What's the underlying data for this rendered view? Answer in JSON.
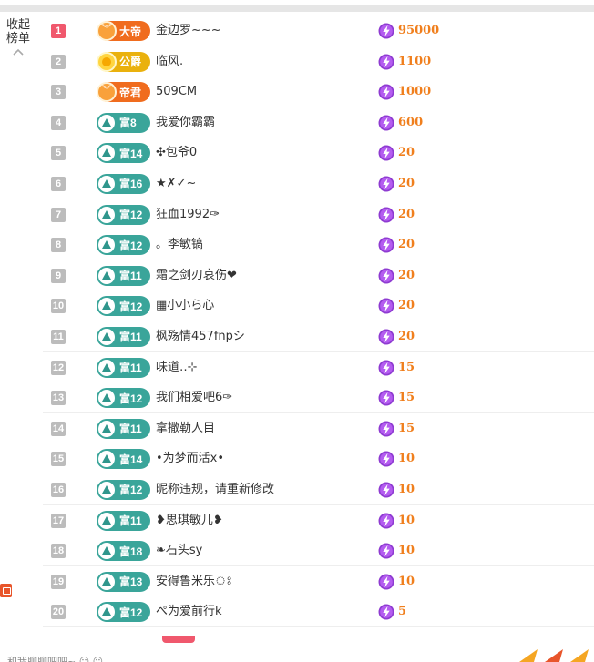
{
  "sidebar": {
    "collapse_label": "收起榜单"
  },
  "colors": {
    "fu_badge": "#3aa59a",
    "noble_orange": "#f06c1e",
    "noble_gold": "#eab10d",
    "amount": "#f07f1d",
    "rank_top": "#f0586d",
    "rank_default": "#bcbcbc",
    "bolt": "#8e3bd1"
  },
  "icons": {
    "collapse": "chevron-up-icon",
    "bolt": "lightning-bolt-icon",
    "fu_gem": "wealth-level-icon",
    "noble_gem": "noble-rank-icon"
  },
  "leaderboard": [
    {
      "rank": "1",
      "badge_type": "orange",
      "badge_label": "大帝",
      "name": "金边罗~~~",
      "amount": "95000"
    },
    {
      "rank": "2",
      "badge_type": "gold",
      "badge_label": "公爵",
      "name": "临风.",
      "amount": "1100"
    },
    {
      "rank": "3",
      "badge_type": "orange",
      "badge_label": "帝君",
      "name": "509CM",
      "amount": "1000"
    },
    {
      "rank": "4",
      "badge_type": "fu",
      "badge_label": "富8",
      "name": "我爱你霸霸",
      "amount": "600"
    },
    {
      "rank": "5",
      "badge_type": "fu",
      "badge_label": "富14",
      "name": "✣包爷0",
      "amount": "20"
    },
    {
      "rank": "6",
      "badge_type": "fu",
      "badge_label": "富16",
      "name": "★✗✓~",
      "amount": "20"
    },
    {
      "rank": "7",
      "badge_type": "fu",
      "badge_label": "富12",
      "name": "狂血1992✑",
      "amount": "20"
    },
    {
      "rank": "8",
      "badge_type": "fu",
      "badge_label": "富12",
      "name": "。李敏镐",
      "amount": "20"
    },
    {
      "rank": "9",
      "badge_type": "fu",
      "badge_label": "富11",
      "name": "霜之剑刃哀伤❤",
      "amount": "20"
    },
    {
      "rank": "10",
      "badge_type": "fu",
      "badge_label": "富12",
      "name": "▦小小ら心",
      "amount": "20"
    },
    {
      "rank": "11",
      "badge_type": "fu",
      "badge_label": "富11",
      "name": "枫殇情457fnpシ",
      "amount": "20"
    },
    {
      "rank": "12",
      "badge_type": "fu",
      "badge_label": "富11",
      "name": "味道‥⊹",
      "amount": "15"
    },
    {
      "rank": "13",
      "badge_type": "fu",
      "badge_label": "富12",
      "name": "我们相爱吧6✑",
      "amount": "15"
    },
    {
      "rank": "14",
      "badge_type": "fu",
      "badge_label": "富11",
      "name": "拿撒勒人目",
      "amount": "15"
    },
    {
      "rank": "15",
      "badge_type": "fu",
      "badge_label": "富14",
      "name": "•为梦而活x•",
      "amount": "10"
    },
    {
      "rank": "16",
      "badge_type": "fu",
      "badge_label": "富12",
      "name": "昵称违规，请重新修改",
      "amount": "10"
    },
    {
      "rank": "17",
      "badge_type": "fu",
      "badge_label": "富11",
      "name": "❥思琪敏儿❥",
      "amount": "10"
    },
    {
      "rank": "18",
      "badge_type": "fu",
      "badge_label": "富18",
      "name": "❧石头sy",
      "amount": "10"
    },
    {
      "rank": "19",
      "badge_type": "fu",
      "badge_label": "富13",
      "name": "安得鲁米乐ঃ",
      "amount": "10"
    },
    {
      "rank": "20",
      "badge_type": "fu",
      "badge_label": "富12",
      "name": "ぺ为爱前行k",
      "amount": "5"
    }
  ],
  "footer": {
    "text": "和我聊聊吧吧~ ☺ ☺"
  }
}
